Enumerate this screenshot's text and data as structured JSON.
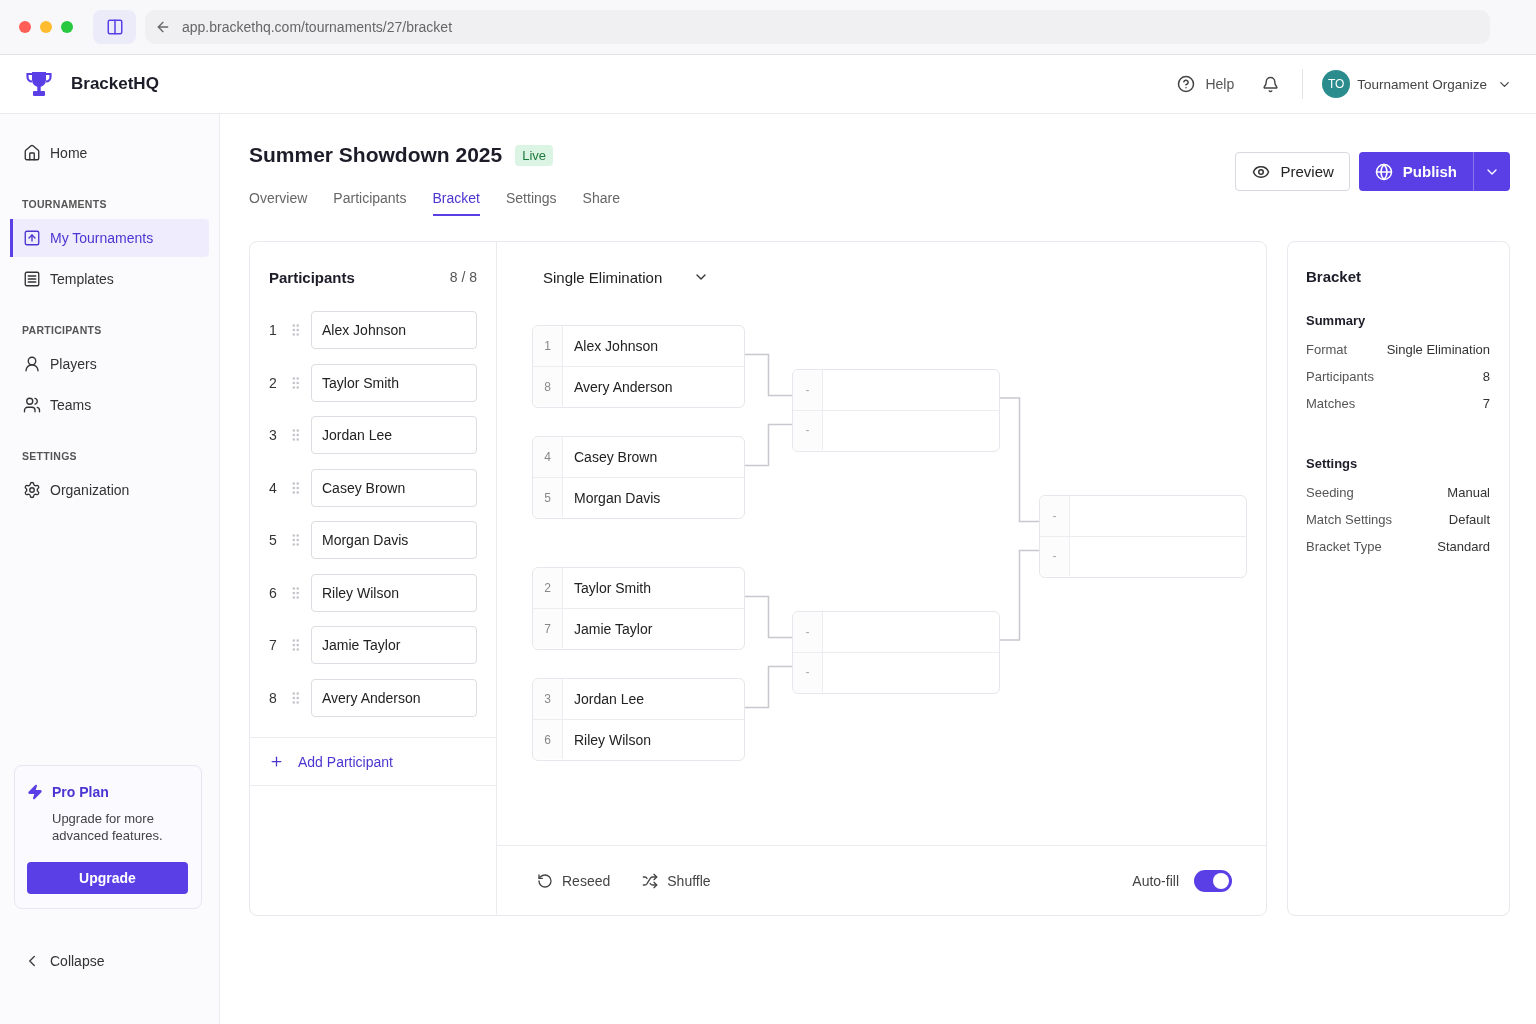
{
  "browser": {
    "url": "app.brackethq.com/tournaments/27/bracket"
  },
  "header": {
    "brand": "BracketHQ",
    "help": "Help",
    "user": {
      "initials": "TO",
      "name": "Tournament Organize"
    }
  },
  "sidebar": {
    "groups": [
      {
        "items": [
          {
            "label": "Home",
            "selected": false
          }
        ]
      },
      {
        "heading": "TOURNAMENTS",
        "items": [
          {
            "label": "My Tournaments",
            "selected": true
          },
          {
            "label": "Templates",
            "selected": false
          }
        ]
      },
      {
        "heading": "PARTICIPANTS",
        "items": [
          {
            "label": "Players",
            "selected": false
          },
          {
            "label": "Teams",
            "selected": false
          }
        ]
      },
      {
        "heading": "SETTINGS",
        "items": [
          {
            "label": "Organization",
            "selected": false
          }
        ]
      }
    ],
    "promo": {
      "title": "Pro Plan",
      "text": "Upgrade for more advanced features.",
      "button": "Upgrade"
    },
    "collapse": "Collapse"
  },
  "page": {
    "title": "Summer Showdown 2025",
    "status": "Live",
    "tabs": [
      {
        "label": "Overview",
        "selected": false
      },
      {
        "label": "Participants",
        "selected": false
      },
      {
        "label": "Bracket",
        "selected": true
      },
      {
        "label": "Settings",
        "selected": false
      },
      {
        "label": "Share",
        "selected": false
      }
    ],
    "actions": {
      "preview": "Preview",
      "publish": "Publish"
    }
  },
  "participants": {
    "title": "Participants",
    "count": "8 / 8",
    "items": [
      {
        "seed": "1",
        "name": "Alex Johnson"
      },
      {
        "seed": "2",
        "name": "Taylor Smith"
      },
      {
        "seed": "3",
        "name": "Jordan Lee"
      },
      {
        "seed": "4",
        "name": "Casey Brown"
      },
      {
        "seed": "5",
        "name": "Morgan Davis"
      },
      {
        "seed": "6",
        "name": "Riley Wilson"
      },
      {
        "seed": "7",
        "name": "Jamie Taylor"
      },
      {
        "seed": "8",
        "name": "Avery Anderson"
      }
    ],
    "add": "Add Participant"
  },
  "bracket": {
    "format": "Single Elimination",
    "rounds": [
      {
        "matches": [
          {
            "slots": [
              {
                "seed": "1",
                "name": "Alex Johnson"
              },
              {
                "seed": "8",
                "name": "Avery Anderson"
              }
            ]
          },
          {
            "slots": [
              {
                "seed": "4",
                "name": "Casey Brown"
              },
              {
                "seed": "5",
                "name": "Morgan Davis"
              }
            ]
          },
          {
            "slots": [
              {
                "seed": "2",
                "name": "Taylor Smith"
              },
              {
                "seed": "7",
                "name": "Jamie Taylor"
              }
            ]
          },
          {
            "slots": [
              {
                "seed": "3",
                "name": "Jordan Lee"
              },
              {
                "seed": "6",
                "name": "Riley Wilson"
              }
            ]
          }
        ]
      },
      {
        "matches": [
          {
            "slots": [
              {
                "seed": "-"
              },
              {
                "seed": "-"
              }
            ]
          },
          {
            "slots": [
              {
                "seed": "-"
              },
              {
                "seed": "-"
              }
            ]
          }
        ]
      },
      {
        "matches": [
          {
            "slots": [
              {
                "seed": "-"
              },
              {
                "seed": "-"
              }
            ]
          }
        ]
      }
    ],
    "reseed": "Reseed",
    "shuffle": "Shuffle",
    "autofill": {
      "label": "Auto-fill",
      "on": true
    }
  },
  "summary": {
    "title": "Bracket",
    "sections": [
      {
        "title": "Summary",
        "rows": [
          {
            "label": "Format",
            "value": "Single Elimination"
          },
          {
            "label": "Participants",
            "value": "8"
          },
          {
            "label": "Matches",
            "value": "7"
          }
        ]
      },
      {
        "title": "Settings",
        "rows": [
          {
            "label": "Seeding",
            "value": "Manual"
          },
          {
            "label": "Match Settings",
            "value": "Default"
          },
          {
            "label": "Bracket Type",
            "value": "Standard"
          }
        ]
      }
    ]
  }
}
